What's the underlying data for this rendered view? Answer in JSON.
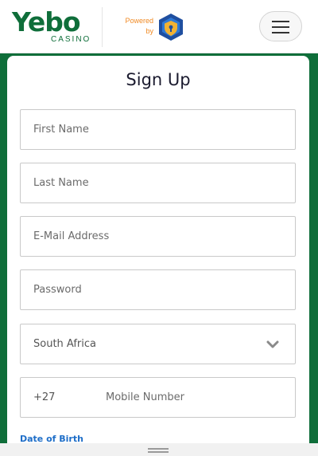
{
  "colors": {
    "brand_green": "#0f6e3a",
    "powered_orange": "#f08a24",
    "link_blue": "#1e6ec8",
    "shield_blue": "#1f4fa0",
    "shield_gold": "#f2b233"
  },
  "header": {
    "logo_word": "Yebo",
    "logo_sub": "CASINO",
    "powered_line1": "Powered",
    "powered_line2": "by",
    "shield_icon": "shield-lock-icon",
    "menu_icon": "hamburger-menu-icon"
  },
  "form": {
    "title": "Sign Up",
    "first_name": "First Name",
    "last_name": "Last Name",
    "email": "E-Mail Address",
    "password": "Password",
    "country": "South Africa",
    "country_icon": "chevron-down-icon",
    "phone_code": "+27",
    "phone_placeholder": "Mobile Number",
    "dob_label": "Date of Birth"
  },
  "bottom": {
    "handle_icon": "drag-handle-icon"
  }
}
